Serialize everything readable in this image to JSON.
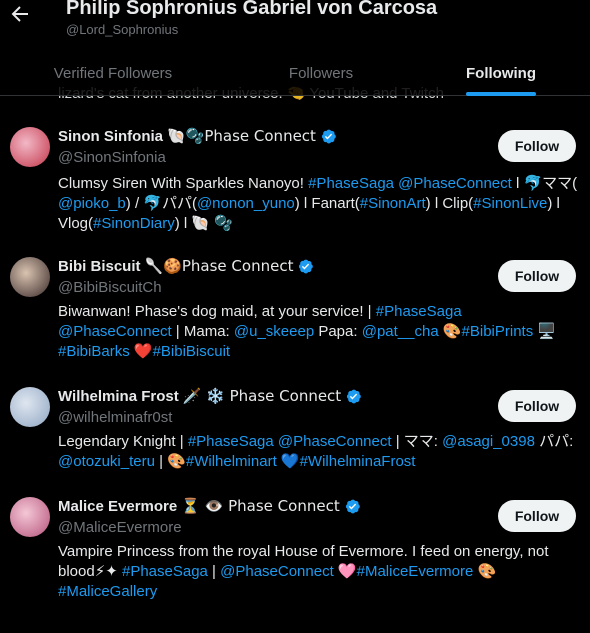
{
  "header": {
    "title": "Philip Sophronius Gabriel von Carcosa",
    "handle": "@Lord_Sophronius"
  },
  "tabs": [
    {
      "label": "Verified Followers",
      "active": false
    },
    {
      "label": "Followers",
      "active": false
    },
    {
      "label": "Following",
      "active": true
    }
  ],
  "peek_text": "lizard's cat from another universe. 🤏 YouTube and Twitch",
  "accounts": [
    {
      "name": "Sinon Sinfonia",
      "name_suffix": "🐚🫧Phase Connect",
      "handle": "@SinonSinfonia",
      "follow_label": "Follow",
      "bio": [
        {
          "t": "Clumsy Siren With Sparkles Nanoyo! "
        },
        {
          "t": "#PhaseSaga",
          "l": true
        },
        {
          "t": " "
        },
        {
          "t": "@PhaseConnect",
          "l": true
        },
        {
          "t": " l 🐬ママ( "
        },
        {
          "t": "@pioko_b",
          "l": true
        },
        {
          "t": ") / 🐬パパ("
        },
        {
          "t": "@nonon_yuno",
          "l": true
        },
        {
          "t": ") l Fanart("
        },
        {
          "t": "#SinonArt",
          "l": true
        },
        {
          "t": ") l Clip("
        },
        {
          "t": "#SinonLive",
          "l": true
        },
        {
          "t": ") l Vlog("
        },
        {
          "t": "#SinonDiary",
          "l": true
        },
        {
          "t": ") l 🐚 🫧"
        }
      ]
    },
    {
      "name": "Bibi Biscuit",
      "name_suffix": "🥄🍪Phase Connect",
      "handle": "@BibiBiscuitCh",
      "follow_label": "Follow",
      "bio": [
        {
          "t": "Biwanwan! Phase's dog maid, at your service! | "
        },
        {
          "t": "#PhaseSaga",
          "l": true
        },
        {
          "t": " "
        },
        {
          "t": "@PhaseConnect",
          "l": true
        },
        {
          "t": " | Mama: "
        },
        {
          "t": "@u_skeeep",
          "l": true
        },
        {
          "t": " Papa: "
        },
        {
          "t": "@pat__cha",
          "l": true
        },
        {
          "t": " 🎨"
        },
        {
          "t": "#BibiPrints",
          "l": true
        },
        {
          "t": " 🖥️ "
        },
        {
          "t": "#BibiBarks",
          "l": true
        },
        {
          "t": " ❤️"
        },
        {
          "t": "#BibiBiscuit",
          "l": true
        }
      ]
    },
    {
      "name": "Wilhelmina Frost",
      "name_suffix": "🗡️ ❄️ Phase Connect",
      "handle": "@wilhelminafr0st",
      "follow_label": "Follow",
      "bio": [
        {
          "t": "Legendary Knight | "
        },
        {
          "t": "#PhaseSaga",
          "l": true
        },
        {
          "t": " "
        },
        {
          "t": "@PhaseConnect",
          "l": true
        },
        {
          "t": " | ママ: "
        },
        {
          "t": "@asagi_0398",
          "l": true
        },
        {
          "t": " パパ: "
        },
        {
          "t": "@otozuki_teru",
          "l": true
        },
        {
          "t": " | 🎨"
        },
        {
          "t": "#Wilhelminart",
          "l": true
        },
        {
          "t": " 💙"
        },
        {
          "t": "#WilhelminaFrost",
          "l": true
        }
      ]
    },
    {
      "name": "Malice Evermore",
      "name_suffix": "⏳ 👁️ Phase Connect",
      "handle": "@MaliceEvermore",
      "follow_label": "Follow",
      "bio": [
        {
          "t": "Vampire Princess from the royal House of Evermore. I feed on energy, not blood⚡✦ "
        },
        {
          "t": "#PhaseSaga",
          "l": true
        },
        {
          "t": " | "
        },
        {
          "t": "@PhaseConnect",
          "l": true
        },
        {
          "t": " 🩷"
        },
        {
          "t": "#MaliceEvermore",
          "l": true
        },
        {
          "t": " 🎨 "
        },
        {
          "t": "#MaliceGallery",
          "l": true
        }
      ]
    }
  ],
  "colors": {
    "accent": "#1d9bf0",
    "background": "#000000",
    "muted": "#71767b",
    "text": "#e7e9ea"
  }
}
